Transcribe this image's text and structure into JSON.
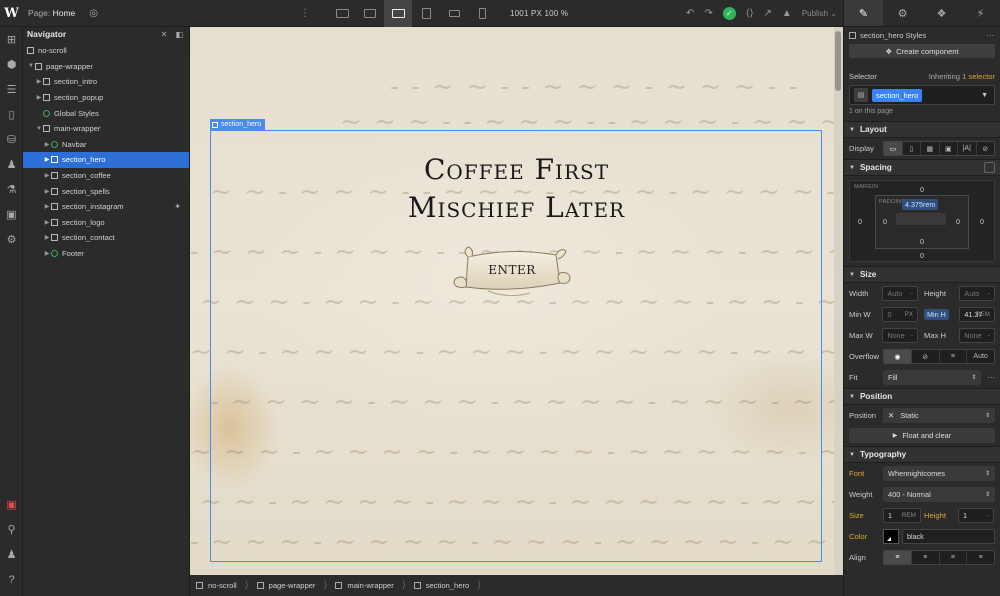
{
  "topbar": {
    "page_prefix": "Page:",
    "page_name": "Home",
    "dims": "1001 PX  100 %",
    "publish_label": "Publish"
  },
  "navigator": {
    "title": "Navigator",
    "items": [
      {
        "label": "no-scroll"
      },
      {
        "label": "page-wrapper"
      },
      {
        "label": "section_intro"
      },
      {
        "label": "section_popup"
      },
      {
        "label": "Global Styles"
      },
      {
        "label": "main-wrapper"
      },
      {
        "label": "Navbar"
      },
      {
        "label": "section_hero"
      },
      {
        "label": "section_coffee"
      },
      {
        "label": "section_spells"
      },
      {
        "label": "section_instagram"
      },
      {
        "label": "section_logo"
      },
      {
        "label": "section_contact"
      },
      {
        "label": "Footer"
      }
    ]
  },
  "canvas": {
    "selected_tag": "section_hero",
    "title_line1": "Coffee First",
    "title_line2": "Mischief Later",
    "button_label": "ENTER"
  },
  "breadcrumbs": [
    "no-scroll",
    "page-wrapper",
    "main-wrapper",
    "section_hero"
  ],
  "styles_panel": {
    "styles_title": "section_hero Styles",
    "create_component": "Create component",
    "selector_label": "Selector",
    "inheriting_prefix": "Inheriting",
    "inheriting_count": "1 selector",
    "selector_chip": "section_hero",
    "on_page": "1 on this page",
    "layout": {
      "title": "Layout",
      "display_label": "Display"
    },
    "spacing": {
      "title": "Spacing",
      "margin_label": "MARGIN",
      "padding_label": "PADDING",
      "margin_top": "0",
      "margin_right": "0",
      "margin_bottom": "0",
      "margin_left": "0",
      "padding_top": "4.375rem",
      "padding_right": "0",
      "padding_bottom": "0",
      "padding_left": "0"
    },
    "size": {
      "title": "Size",
      "width_label": "Width",
      "width_val": "Auto",
      "height_label": "Height",
      "height_val": "Auto",
      "minw_label": "Min W",
      "minw_val": "0",
      "minw_unit": "PX",
      "minh_label": "Min H",
      "minh_val": "41.37",
      "minh_unit": "REM",
      "maxw_label": "Max W",
      "maxw_val": "None",
      "maxh_label": "Max H",
      "maxh_val": "None",
      "overflow_label": "Overflow",
      "overflow_auto": "Auto",
      "fit_label": "Fit",
      "fit_val": "Fill"
    },
    "position": {
      "title": "Position",
      "position_label": "Position",
      "position_val": "Static",
      "float_label": "Float and clear"
    },
    "typography": {
      "title": "Typography",
      "font_label": "Font",
      "font_val": "Whennightcomes",
      "weight_label": "Weight",
      "weight_val": "400 - Normal",
      "size_label": "Size",
      "size_val": "1",
      "size_unit": "REM",
      "height_label": "Height",
      "height_val": "1",
      "color_label": "Color",
      "color_val": "black",
      "align_label": "Align"
    }
  },
  "colors": {
    "accent": "#4a8bf0",
    "selection": "#2d6fd6",
    "inherit": "#e0a630",
    "status_ok": "#2fb55b"
  }
}
